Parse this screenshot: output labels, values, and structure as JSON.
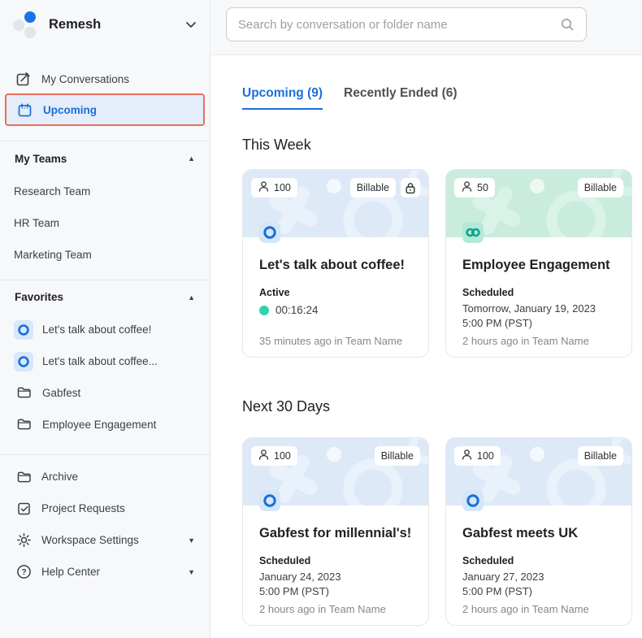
{
  "app": {
    "name": "Remesh"
  },
  "colors": {
    "accent": "#1a6fd8",
    "highlight_border": "#e9705a",
    "banner_blue": "#dee9f7",
    "banner_green": "#c9ecdd",
    "teal_dot": "#2fd3ae",
    "teal_icon": "#0fa58a"
  },
  "search": {
    "placeholder": "Search by conversation or folder name",
    "value": ""
  },
  "sidebar": {
    "primary": [
      {
        "label": "My Conversations",
        "icon": "compose-icon",
        "active": false
      },
      {
        "label": "Upcoming",
        "icon": "calendar-icon",
        "active": true
      }
    ],
    "teams": {
      "title": "My Teams",
      "collapse": "up",
      "items": [
        {
          "label": "Research Team"
        },
        {
          "label": "HR Team"
        },
        {
          "label": "Marketing Team"
        }
      ]
    },
    "favorites": {
      "title": "Favorites",
      "collapse": "up",
      "items": [
        {
          "label": "Let's talk about coffee!",
          "icon": "conversation-icon"
        },
        {
          "label": "Let's talk about coffee...",
          "icon": "conversation-icon"
        },
        {
          "label": "Gabfest",
          "icon": "folder-icon"
        },
        {
          "label": "Employee Engagement",
          "icon": "folder-icon"
        }
      ]
    },
    "bottom": [
      {
        "label": "Archive",
        "icon": "folder-icon",
        "expand": null
      },
      {
        "label": "Project Requests",
        "icon": "project-requests-icon",
        "expand": null
      },
      {
        "label": "Workspace Settings",
        "icon": "gear-icon",
        "expand": "down"
      },
      {
        "label": "Help Center",
        "icon": "help-icon",
        "expand": "down"
      }
    ]
  },
  "tabs": [
    {
      "label": "Upcoming (9)",
      "active": true
    },
    {
      "label": "Recently Ended (6)",
      "active": false
    }
  ],
  "sections": [
    {
      "heading": "This Week",
      "cards": [
        {
          "theme": "blue",
          "participants": "100",
          "billable_label": "Billable",
          "locked": true,
          "badge_icon": "ring-icon",
          "title": "Let's talk about coffee!",
          "status": "Active",
          "timer": "00:16:24",
          "date_lines": [],
          "footer": "35 minutes ago in Team Name"
        },
        {
          "theme": "green",
          "participants": "50",
          "billable_label": "Billable",
          "locked": false,
          "badge_icon": "infinity-icon",
          "title": "Employee Engagement",
          "status": "Scheduled",
          "timer": null,
          "date_lines": [
            "Tomorrow, January 19, 2023",
            "5:00 PM (PST)"
          ],
          "footer": "2 hours ago in Team Name"
        }
      ]
    },
    {
      "heading": "Next 30 Days",
      "cards": [
        {
          "theme": "blue",
          "participants": "100",
          "billable_label": "Billable",
          "locked": false,
          "badge_icon": "ring-icon",
          "title": "Gabfest for millennial's!",
          "status": "Scheduled",
          "timer": null,
          "date_lines": [
            "January 24, 2023",
            "5:00 PM (PST)"
          ],
          "footer": "2 hours ago in Team Name"
        },
        {
          "theme": "blue",
          "participants": "100",
          "billable_label": "Billable",
          "locked": false,
          "badge_icon": "ring-icon",
          "title": "Gabfest meets UK",
          "status": "Scheduled",
          "timer": null,
          "date_lines": [
            "January 27, 2023",
            "5:00 PM (PST)"
          ],
          "footer": "2 hours ago in Team Name"
        }
      ]
    }
  ]
}
